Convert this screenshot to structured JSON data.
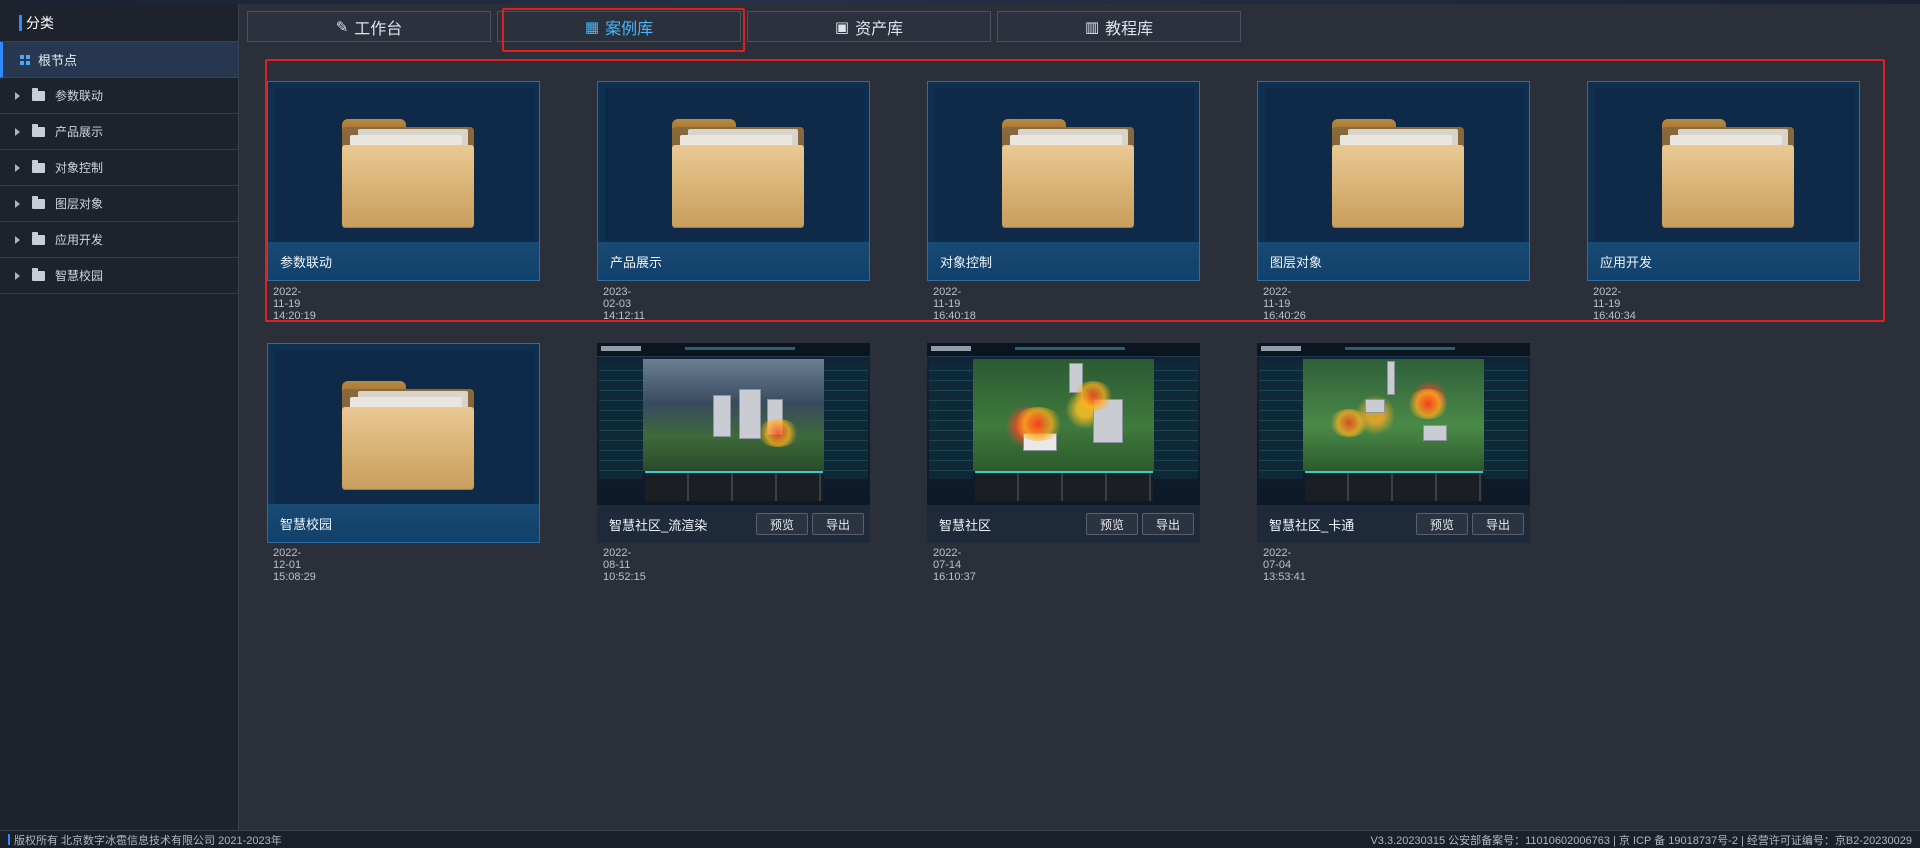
{
  "sidebar": {
    "title": "分类",
    "root_label": "根节点",
    "items": [
      {
        "label": "参数联动"
      },
      {
        "label": "产品展示"
      },
      {
        "label": "对象控制"
      },
      {
        "label": "图层对象"
      },
      {
        "label": "应用开发"
      },
      {
        "label": "智慧校园"
      }
    ]
  },
  "tabs": [
    {
      "label": "工作台",
      "icon": "edit-icon"
    },
    {
      "label": "案例库",
      "icon": "grid-icon",
      "active": true
    },
    {
      "label": "资产库",
      "icon": "briefcase-icon"
    },
    {
      "label": "教程库",
      "icon": "book-icon"
    }
  ],
  "cards": [
    {
      "type": "folder",
      "name": "参数联动",
      "date": "2022-11-19 14:20:19"
    },
    {
      "type": "folder",
      "name": "产品展示",
      "date": "2023-02-03 14:12:11"
    },
    {
      "type": "folder",
      "name": "对象控制",
      "date": "2022-11-19 16:40:18"
    },
    {
      "type": "folder",
      "name": "图层对象",
      "date": "2022-11-19 16:40:26"
    },
    {
      "type": "folder",
      "name": "应用开发",
      "date": "2022-11-19 16:40:34"
    },
    {
      "type": "folder",
      "name": "智慧校园",
      "date": "2022-12-01 15:08:29"
    },
    {
      "type": "project",
      "name": "智慧社区_流渲染",
      "date": "2022-08-11 10:52:15",
      "preview_label": "预览",
      "export_label": "导出"
    },
    {
      "type": "project",
      "name": "智慧社区",
      "date": "2022-07-14 16:10:37",
      "preview_label": "预览",
      "export_label": "导出"
    },
    {
      "type": "project",
      "name": "智慧社区_卡通",
      "date": "2022-07-04 13:53:41",
      "preview_label": "预览",
      "export_label": "导出"
    }
  ],
  "footer": {
    "copyright": "版权所有 北京数字冰雹信息技术有限公司 2021-2023年",
    "version_info": "V3.3.20230315 公安部备案号：11010602006763 | 京 ICP 备 19018737号-2 | 经营许可证编号：京B2-20230029"
  },
  "colors": {
    "accent": "#2f8bff",
    "active_tab": "#45b6ff",
    "highlight_outline": "#e02020",
    "card_bg": "#0f2f50"
  }
}
